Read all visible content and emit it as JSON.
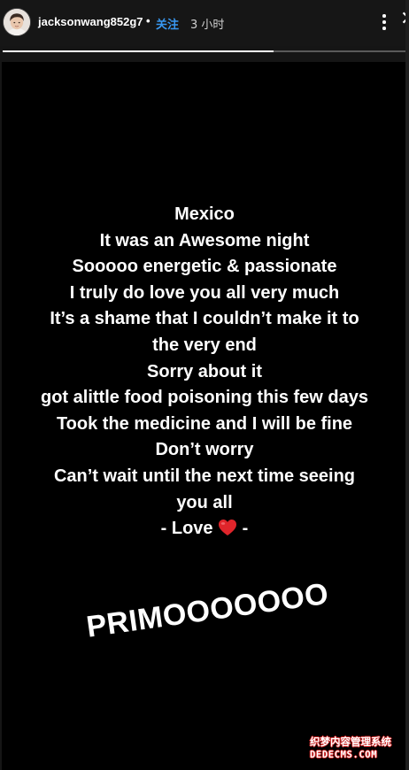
{
  "header": {
    "username": "jacksonwang852g7",
    "separator": "•",
    "follow_label": "关注",
    "timestamp": "3 小时",
    "more_icon": "more-horizontal-icon",
    "close_icon": "close-icon",
    "avatar_icon": "profile-avatar"
  },
  "progress": {
    "fraction": 0.67,
    "track_color": "#5a5a5a",
    "fill_color": "#ffffff"
  },
  "story": {
    "background": "#000000",
    "text_color": "#ffffff",
    "lines": [
      "Mexico",
      "It was an Awesome night",
      "Sooooo energetic & passionate",
      "I truly do love you all very much",
      "It’s a shame that I couldn’t make it to",
      "the very end",
      "Sorry about it",
      "got alittle food poisoning this few days",
      "Took the medicine and I will be fine",
      "Don’t worry",
      "Can’t wait until the next time seeing",
      "you all"
    ],
    "sign_off_prefix": "- Love",
    "sign_off_suffix": "-",
    "heart_icon": "red-heart-icon",
    "heart_color": "#e0252b",
    "sticker_text": "PRIMOOOOOOO"
  },
  "watermark": {
    "line1": "织梦内容管理系统",
    "line2": "DEDECMS.COM",
    "outline_color": "#c81e1e"
  },
  "colors": {
    "follow_blue": "#3897f0",
    "chrome_bg": "#161616"
  }
}
